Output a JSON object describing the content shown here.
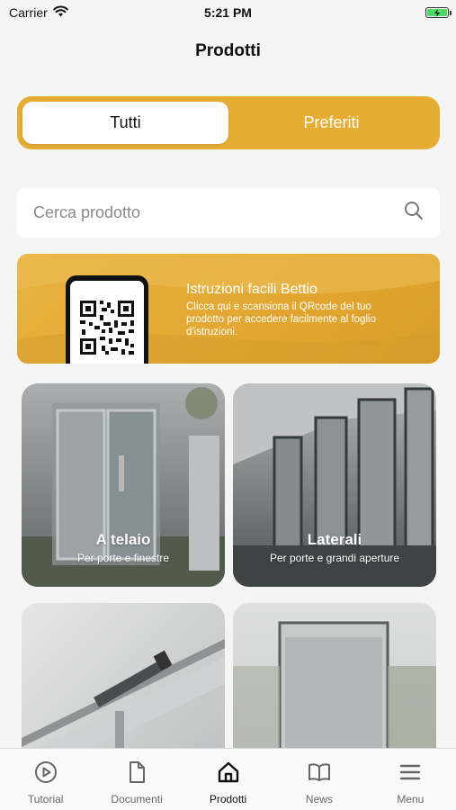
{
  "status_bar": {
    "carrier": "Carrier",
    "time": "5:21 PM"
  },
  "header": {
    "title": "Prodotti"
  },
  "segments": [
    {
      "label": "Tutti",
      "active": true
    },
    {
      "label": "Preferiti",
      "active": false
    }
  ],
  "search": {
    "placeholder": "Cerca prodotto",
    "value": ""
  },
  "banner": {
    "title": "Istruzioni facili Bettio",
    "description": "Clicca qui e scansiona il QRcode del tuo prodotto per accedere facilmente al foglio d'istruzioni."
  },
  "products": [
    {
      "title": "A telaio",
      "subtitle": "Per porte e finestre"
    },
    {
      "title": "Laterali",
      "subtitle": "Per porte e grandi aperture"
    },
    {
      "title": "",
      "subtitle": ""
    },
    {
      "title": "",
      "subtitle": ""
    }
  ],
  "tabbar": [
    {
      "label": "Tutorial",
      "icon": "play-circle-icon",
      "active": false
    },
    {
      "label": "Documenti",
      "icon": "document-icon",
      "active": false
    },
    {
      "label": "Prodotti",
      "icon": "home-icon",
      "active": true
    },
    {
      "label": "News",
      "icon": "book-icon",
      "active": false
    },
    {
      "label": "Menu",
      "icon": "hamburger-icon",
      "active": false
    }
  ],
  "colors": {
    "accent": "#e6ad35",
    "background": "#f5f5f5",
    "battery": "#4cd964"
  }
}
